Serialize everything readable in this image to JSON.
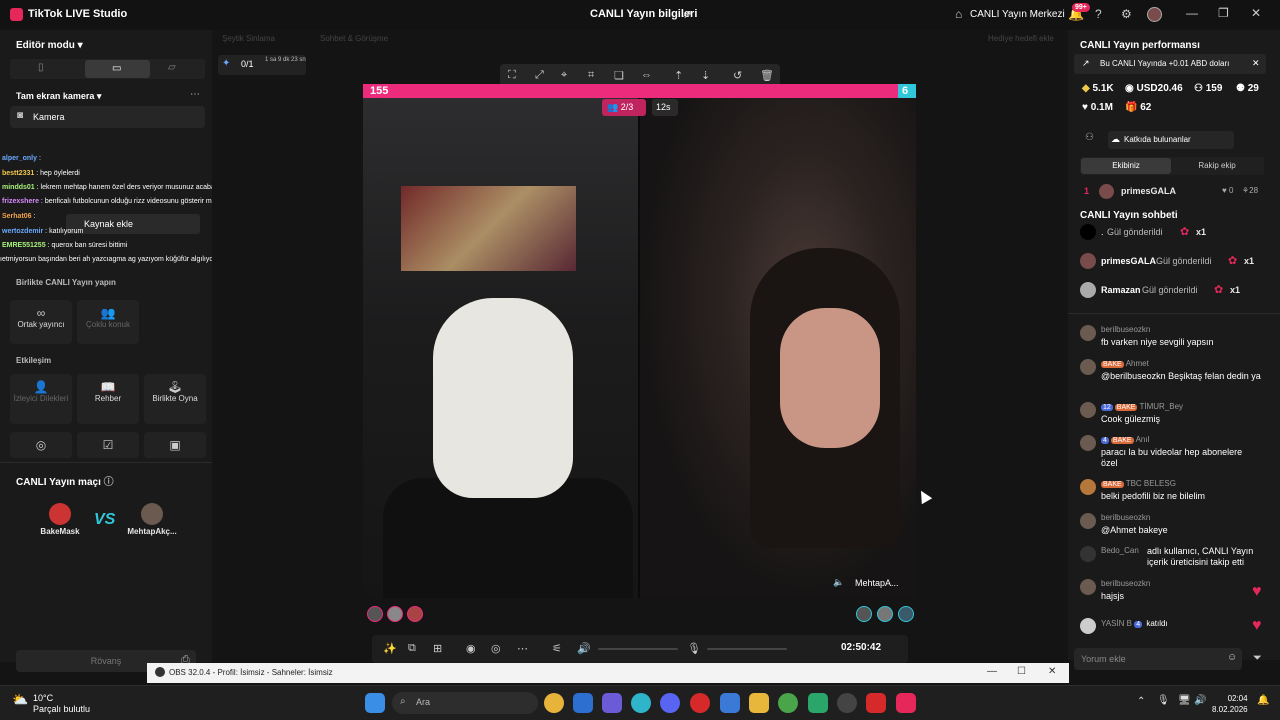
{
  "app": {
    "title": "TikTok LIVE Studio"
  },
  "header": {
    "live_info": "CANLI Yayın bilgileri",
    "live_center": "CANLI Yayın Merkezi",
    "notif_badge": "99+"
  },
  "left": {
    "editor_mode": "Editör modu",
    "source_title": "Tam ekran kamera",
    "camera_label": "Kamera",
    "tooltip": "Kaynak ekle",
    "chat": [
      {
        "user": "alper_only",
        "msg": ""
      },
      {
        "user": "bestt2331",
        "msg": "hep öylelerdi"
      },
      {
        "user": "mindds01",
        "msg": "lekrem mehtap hanem özel ders veriyor musunuz acaba benim matamatiğim çok kötü"
      },
      {
        "user": "frizexshere",
        "msg": "benficalı futbolcunun olduğu rizz videosunu gösterir misin @BakeMask"
      },
      {
        "user": "Serhat06",
        "msg": ""
      },
      {
        "user": "wertozdemir",
        "msg": "katılıyorum"
      },
      {
        "user": "EMRE551255",
        "msg": "querox ban süresi bittimi"
      },
      {
        "user": "",
        "msg": "ıetmiyorsun başından beri ah yazcıagma ag yazıyom küğüfür algılıyor mk"
      }
    ],
    "together_title": "Birlikte CANLI Yayın yapın",
    "cohost": "Ortak yayıncı",
    "multi_guest": "Çoklu konuk",
    "interaction_title": "Etkileşim",
    "viewer_requests": "İzleyici Dilekleri",
    "guide": "Rehber",
    "play_together": "Birlikte Oyna",
    "match_title": "CANLI Yayın maçı",
    "player1": "BakeMask",
    "player2": "MehtapAkç...",
    "vs": "VS",
    "rematch": "Rövanş",
    "top_tabs": [
      "Şeytik Sinlama",
      "Sohbet & Görüşme",
      "Hediye hedefi ekle"
    ],
    "top_counter": "0/1",
    "top_time": "1 sa 9 dk 23 sn"
  },
  "video": {
    "score_left": "155",
    "score_right": "6",
    "participants": "2/3",
    "countdown": "12s",
    "right_name": "MehtapA...",
    "timer": "02:50:42"
  },
  "obs": {
    "title": "OBS 32.0.4 - Profil: İsimsiz - Sahneler: İsimsiz"
  },
  "right": {
    "perf_title": "CANLI Yayın performansı",
    "notice": "Bu CANLI Yayında +0.01 ABD doları",
    "stats": [
      "5.1K",
      "USD20.46",
      "159",
      "29",
      "0.1M",
      "62"
    ],
    "contributors": "Katkıda bulunanlar",
    "tab_team": "Ekibiniz",
    "tab_rival": "Rakip ekip",
    "rank": {
      "pos": "1",
      "name": "primesGALA",
      "likes": "0",
      "count": "28"
    },
    "chat_title": "CANLI Yayın sohbeti",
    "gifts": [
      {
        "user": ".",
        "text": "Gül gönderildi",
        "count": "x1"
      },
      {
        "user": "primesGALA",
        "text": "Gül gönderildi",
        "count": "x1"
      },
      {
        "user": "Ramazan",
        "text": "Gül gönderildi",
        "count": "x1"
      }
    ],
    "comments": [
      {
        "user": "berilbuseozkn",
        "badges": [],
        "msg": "fb varken niye sevgili yapsın"
      },
      {
        "user": "Ahmet",
        "badges": [
          "BAKE"
        ],
        "msg": "@berilbuseozkn Beşiktaş felan dedin ya"
      },
      {
        "user": "TİMUR_Bey",
        "badges": [
          "12",
          "BAKE"
        ],
        "msg": "Cook gülezmiş"
      },
      {
        "user": "Anıl",
        "badges": [
          "4",
          "BAKE"
        ],
        "msg": "paracı la bu videolar hep abonelere özel"
      },
      {
        "user": "TBC BELESG",
        "badges": [
          "BAKE"
        ],
        "msg": "belki pedofili biz ne bilelim"
      },
      {
        "user": "berilbuseozkn",
        "badges": [],
        "msg": "@Ahmet bakeye"
      },
      {
        "user": "Bedo_Can",
        "badges": [],
        "msg": "adlı kullanıcı, CANLI Yayın içerik üreticisini takip etti"
      },
      {
        "user": "berilbuseozkn",
        "badges": [],
        "msg": "hajsjs"
      },
      {
        "user": "YASİN B",
        "badges": [
          "4"
        ],
        "msg": "katıldı"
      }
    ],
    "comment_placeholder": "Yorum ekle"
  },
  "taskbar": {
    "temp": "10°C",
    "weather": "Parçalı bulutlu",
    "search": "Ara",
    "time": "02:04",
    "date": "8.02.2026"
  }
}
